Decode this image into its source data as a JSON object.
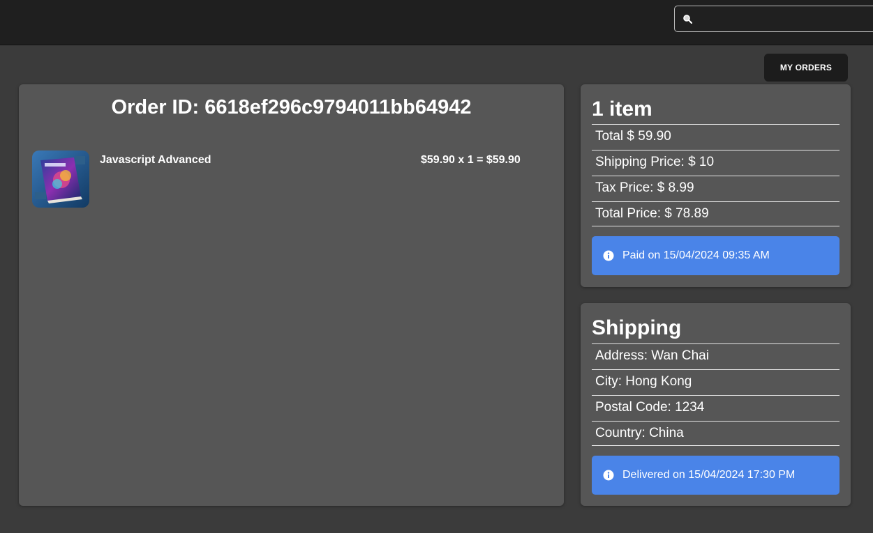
{
  "header": {
    "search": {
      "placeholder": "",
      "value": "",
      "icon": "search-icon"
    }
  },
  "toolbar": {
    "my_orders_label": "MY ORDERS"
  },
  "order": {
    "title": "Order ID: 6618ef296c9794011bb64942",
    "items": [
      {
        "name": "Javascript Advanced",
        "price_line": "$59.90 x 1 = $59.90",
        "image": "book-cover-thumbnail"
      }
    ]
  },
  "summary": {
    "heading": "1 item",
    "rows": [
      "Total $ 59.90",
      "Shipping Price: $ 10",
      "Tax Price: $ 8.99",
      "Total Price: $ 78.89"
    ],
    "status": "Paid on 15/04/2024 09:35 AM",
    "status_icon": "info-icon"
  },
  "shipping": {
    "heading": "Shipping",
    "rows": [
      "Address: Wan Chai",
      "City: Hong Kong",
      "Postal Code: 1234",
      "Country: China"
    ],
    "status": "Delivered on 15/04/2024 17:30 PM",
    "status_icon": "info-icon"
  },
  "colors": {
    "topbar": "#1f1f1f",
    "page_background": "#3b3b3b",
    "card": "#565656",
    "alert_info": "#4a84e8",
    "button_dark": "#1c1c1c"
  }
}
